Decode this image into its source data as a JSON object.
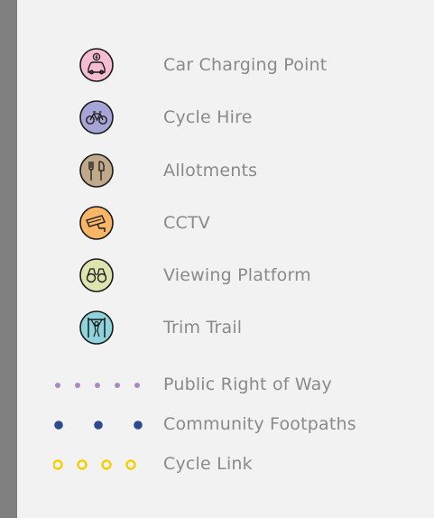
{
  "legend": {
    "items": [
      {
        "label": "Car Charging Point",
        "icon": "car-charging-icon",
        "fill": "#f6bcd2"
      },
      {
        "label": "Cycle Hire",
        "icon": "bicycle-icon",
        "fill": "#a7a5d6"
      },
      {
        "label": "Allotments",
        "icon": "fork-spade-icon",
        "fill": "#bfa98a"
      },
      {
        "label": "CCTV",
        "icon": "cctv-camera-icon",
        "fill": "#f7b567"
      },
      {
        "label": "Viewing Platform",
        "icon": "binoculars-icon",
        "fill": "#dfe3ae"
      },
      {
        "label": "Trim Trail",
        "icon": "trim-trail-icon",
        "fill": "#8fd4dc"
      }
    ],
    "lines": [
      {
        "label": "Public Right of Way",
        "style": "small-dots",
        "color": "#a98ac4"
      },
      {
        "label": "Community Footpaths",
        "style": "large-dots",
        "color": "#2d4a8f"
      },
      {
        "label": "Cycle Link",
        "style": "hollow-dots",
        "color": "#f2d000"
      }
    ]
  }
}
